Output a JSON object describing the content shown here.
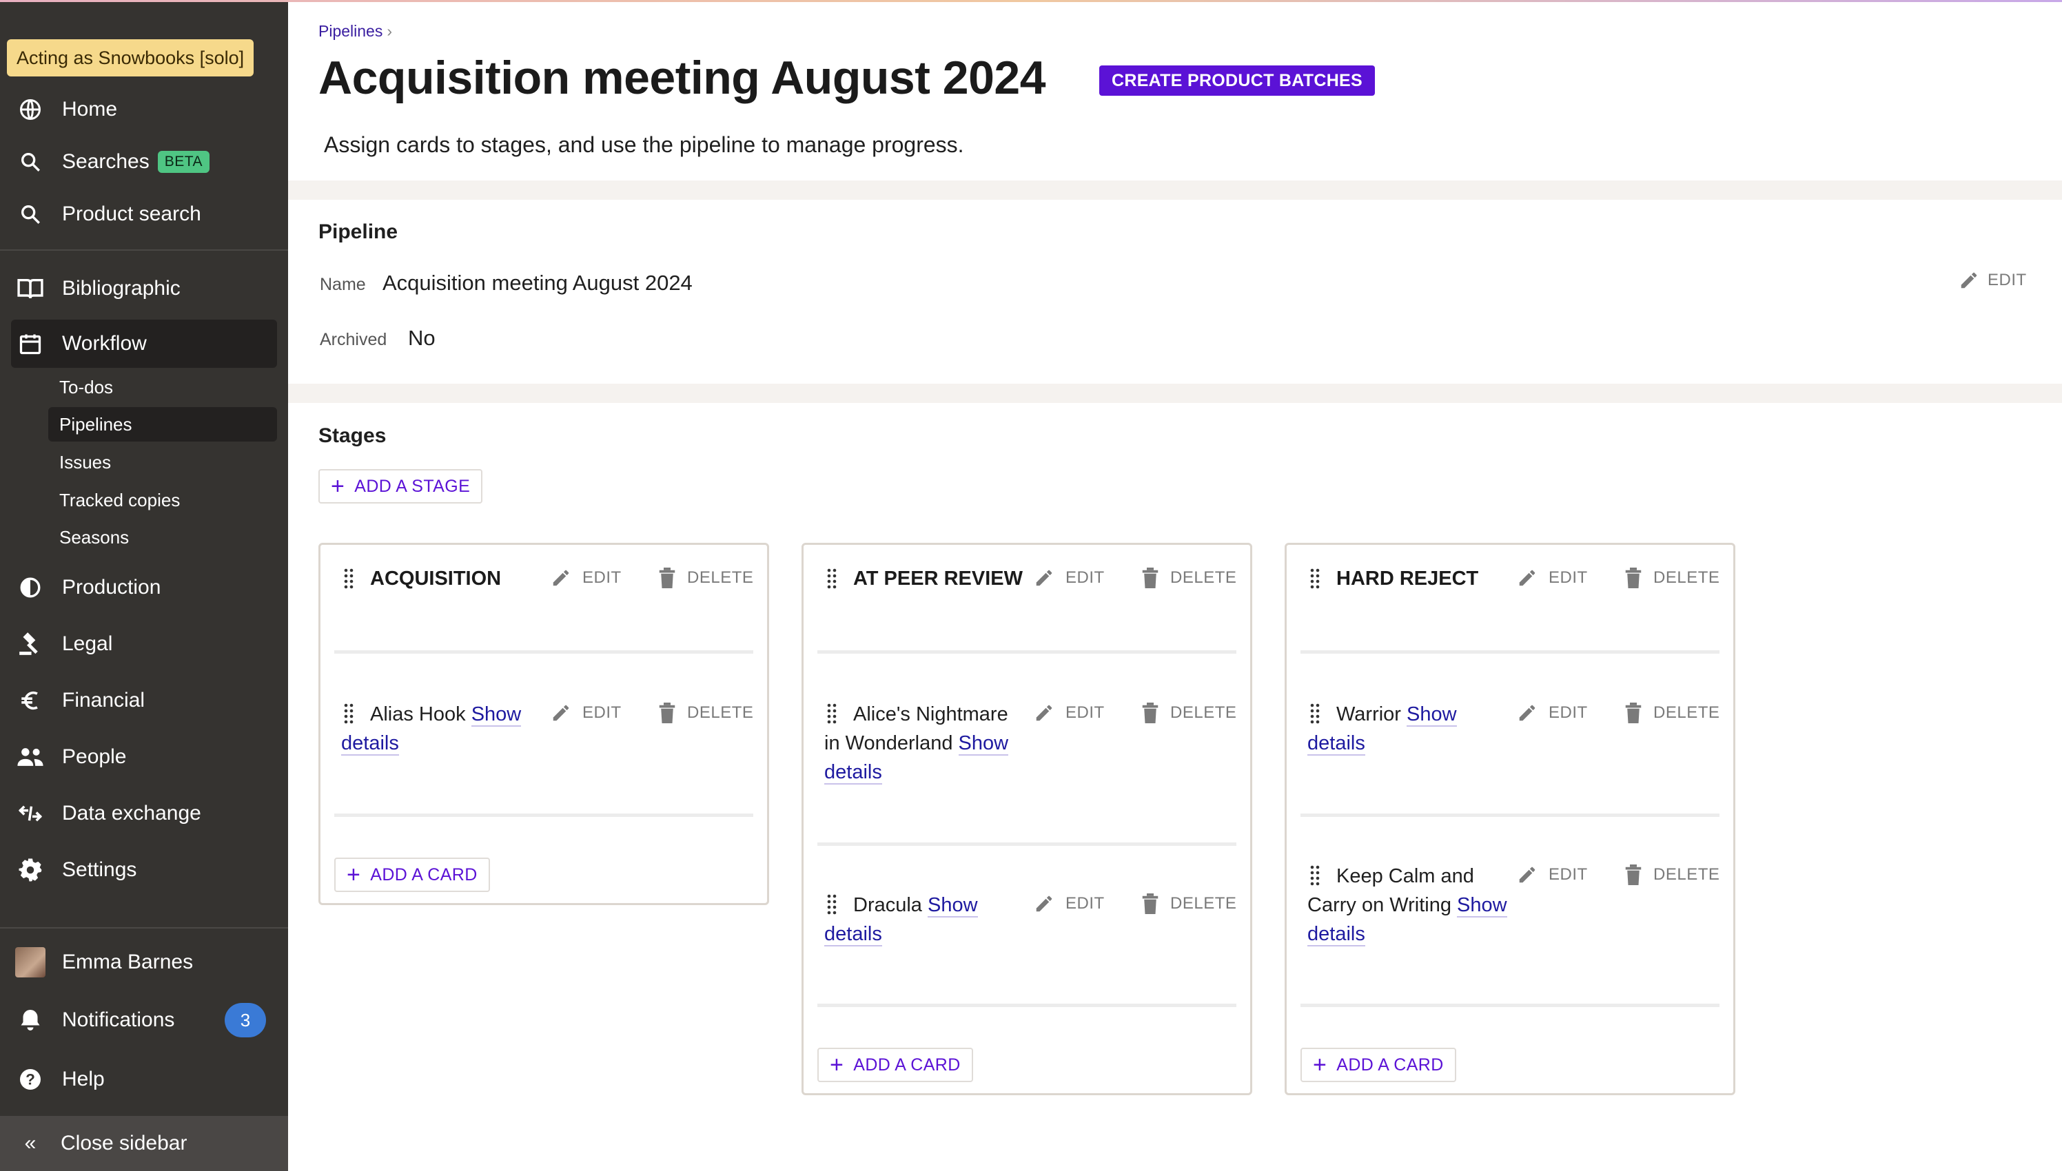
{
  "sidebar": {
    "acting_as": "Acting as Snowbooks [solo]",
    "items": [
      {
        "label": "Home",
        "icon": "globe-icon"
      },
      {
        "label": "Searches",
        "icon": "search-icon",
        "badge": "BETA"
      },
      {
        "label": "Product search",
        "icon": "search-icon"
      },
      {
        "label": "Bibliographic",
        "icon": "book-icon"
      },
      {
        "label": "Workflow",
        "icon": "calendar-icon",
        "active": true
      },
      {
        "label": "Production",
        "icon": "half-circle-icon"
      },
      {
        "label": "Legal",
        "icon": "gavel-icon"
      },
      {
        "label": "Financial",
        "icon": "euro-icon"
      },
      {
        "label": "People",
        "icon": "people-icon"
      },
      {
        "label": "Data exchange",
        "icon": "exchange-icon"
      },
      {
        "label": "Settings",
        "icon": "gear-icon"
      }
    ],
    "workflow_sub": [
      {
        "label": "To-dos"
      },
      {
        "label": "Pipelines",
        "active": true
      },
      {
        "label": "Issues"
      },
      {
        "label": "Tracked copies"
      },
      {
        "label": "Seasons"
      }
    ],
    "user": {
      "name": "Emma Barnes"
    },
    "notifications": {
      "label": "Notifications",
      "count": "3"
    },
    "help": "Help",
    "close": "Close sidebar",
    "close_glyph": "«"
  },
  "page": {
    "breadcrumb": "Pipelines",
    "breadcrumb_sep": "›",
    "title": "Acquisition meeting August 2024",
    "primary_action": "CREATE PRODUCT BATCHES",
    "lead": "Assign cards to stages, and use the pipeline to manage progress."
  },
  "pipeline": {
    "heading": "Pipeline",
    "name_label": "Name",
    "name_value": "Acquisition meeting August 2024",
    "archived_label": "Archived",
    "archived_value": "No",
    "edit_label": "EDIT"
  },
  "stages_section": {
    "heading": "Stages",
    "add_stage": "ADD A STAGE",
    "edit_label": "EDIT",
    "delete_label": "DELETE",
    "add_card": "ADD A CARD",
    "show_word": "Show",
    "details_word": "details"
  },
  "stages": [
    {
      "name": "ACQUISITION",
      "cards": [
        {
          "title": "Alias Hook"
        }
      ]
    },
    {
      "name": "AT PEER REVIEW",
      "cards": [
        {
          "title": "Alice's Nightmare in Wonderland"
        },
        {
          "title": "Dracula"
        }
      ]
    },
    {
      "name": "HARD REJECT",
      "cards": [
        {
          "title": "Warrior"
        },
        {
          "title": "Keep Calm and Carry on Writing"
        }
      ]
    }
  ],
  "colors": {
    "sidebar_bg": "#353330",
    "accent": "#5b12d6",
    "link": "#1e1aa0",
    "acting_bg": "#f6d98b",
    "beta_bg": "#4fc583",
    "badge_bg": "#3a7ad6"
  }
}
